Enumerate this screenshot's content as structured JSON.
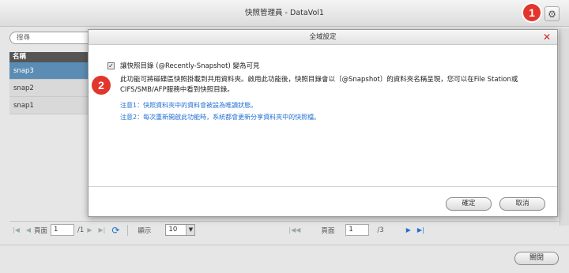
{
  "window": {
    "title": "快照管理員 - DataVol1"
  },
  "callouts": {
    "one": "1",
    "two": "2"
  },
  "search": {
    "placeholder": "搜尋"
  },
  "list": {
    "header": "名稱",
    "rows": [
      "snap3",
      "snap2",
      "snap1"
    ],
    "selected": "snap3"
  },
  "pager_left": {
    "page_label": "頁面",
    "page_value": "1",
    "page_total": "/1",
    "show_label": "顯示",
    "show_value": "10"
  },
  "pager_right": {
    "page_label": "頁面",
    "page_value": "1",
    "page_total": "/3"
  },
  "close_button": "關閉",
  "modal": {
    "title": "全域設定",
    "checkbox_label": "讓快照目錄 (@Recently-Snapshot) 變為可見",
    "checkbox_checked": true,
    "description": "此功能可將磁碟區快照掛載到共用資料夾。啟用此功能後，快照目錄會以〔@Snapshot〕的資料夾名稱呈現，您可以在File Station或CIFS/SMB/AFP服務中看到快照目錄。",
    "note1": "注意1：快照資料夾中的資料會被設為唯讀狀態。",
    "note2": "注意2：每次重新開啟此功能時，系統都會更新分享資料夾中的快照檔。",
    "ok_button": "確定",
    "cancel_button": "取消"
  },
  "colors": {
    "accent": "#1f6fd1",
    "callout": "#e2352c",
    "selected_row": "#5b8db4",
    "close_x": "#d21f1f"
  },
  "icons": [
    "gear-icon",
    "close-icon",
    "first-page-icon",
    "prev-page-icon",
    "next-page-icon",
    "last-page-icon",
    "refresh-icon",
    "chevron-down-icon"
  ]
}
